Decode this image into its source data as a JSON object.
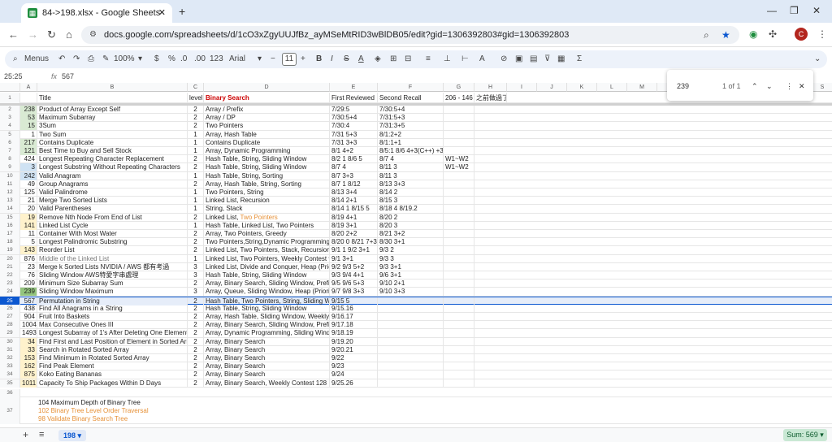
{
  "browser": {
    "tab_title": "84->198.xlsx - Google Sheets",
    "url": "docs.google.com/spreadsheets/d/1cO3xZgyUUJfBz_ayMSeMtRID3wBlDB05/edit?gid=1306392803#gid=1306392803",
    "avatar_letter": "C"
  },
  "toolbar": {
    "menus": "Menus",
    "zoom": "100%",
    "currency": "$",
    "percent": "%",
    "dec_down": ".0",
    "dec_up": ".00",
    "format123": "123",
    "font": "Arial",
    "font_size": "11"
  },
  "formula": {
    "namebox": "25:25",
    "fx": "fx",
    "value": "567"
  },
  "find": {
    "query": "239",
    "count": "1 of 1"
  },
  "columns": [
    "A",
    "B",
    "C",
    "D",
    "E",
    "F",
    "G",
    "H",
    "I",
    "J",
    "K",
    "L",
    "M",
    "N",
    "O",
    "P",
    "Q",
    "R",
    "S"
  ],
  "header_row": {
    "title": "Title",
    "level": "level",
    "tag": "Binary Search",
    "first": "First Reviewed",
    "second": "Second Recall",
    "g": "206 - 146",
    "h": "之前做過了"
  },
  "rows": [
    {
      "n": "2",
      "a": "238",
      "b": "Product of Array Except Self",
      "c": "2",
      "d": "Array / Prefix",
      "e": "7/29:5",
      "f": "7/30:5+4",
      "g": ""
    },
    {
      "n": "3",
      "a": "53",
      "b": "Maximum Subarray",
      "c": "2",
      "d": "Array / DP",
      "e": "7/30:5+4",
      "f": "7/31:5+3",
      "g": ""
    },
    {
      "n": "4",
      "a": "15",
      "b": "3Sum",
      "c": "2",
      "d": "Two Pointers",
      "e": "7/30:4",
      "f": "7/31:3+5",
      "g": ""
    },
    {
      "n": "5",
      "a": "1",
      "b": "Two Sum",
      "c": "1",
      "d": "Array, Hash Table",
      "e": "7/31 5+3",
      "f": "8/1:2+2",
      "g": ""
    },
    {
      "n": "6",
      "a": "217",
      "b": "Contains Duplicate",
      "c": "1",
      "d": "Contains Duplicate",
      "e": "7/31 3+3",
      "f": "8/1:1+1",
      "g": ""
    },
    {
      "n": "7",
      "a": "121",
      "b": "Best Time to Buy and Sell Stock",
      "c": "1",
      "d": "Array, Dynamic Programming",
      "e": "8/1 4+2",
      "f": "8/5:1 8/6 4+3(C++) +3",
      "g": ""
    },
    {
      "n": "8",
      "a": "424",
      "b": "Longest Repeating Character Replacement",
      "c": "2",
      "d": "Hash Table, String, Sliding Window",
      "e": "8/2 1 8/6 5",
      "f": "8/7 4",
      "g": "W1~W2"
    },
    {
      "n": "9",
      "a": "3",
      "b": "Longest Substring Without Repeating Characters",
      "c": "2",
      "d": "Hash Table, String, Sliding Window",
      "e": "8/7 4",
      "f": "8/11 3",
      "g": "W1~W2"
    },
    {
      "n": "10",
      "a": "242",
      "b": "Valid Anagram",
      "c": "1",
      "d": "Hash Table, String, Sorting",
      "e": "8/7 3+3",
      "f": "8/11 3",
      "g": ""
    },
    {
      "n": "11",
      "a": "49",
      "b": "Group Anagrams",
      "c": "2",
      "d": "Array, Hash Table, String, Sorting",
      "e": "8/7 1 8/12",
      "f": "8/13 3+3",
      "g": ""
    },
    {
      "n": "12",
      "a": "125",
      "b": "Valid Palindrome",
      "c": "1",
      "d": "Two Pointers, String",
      "e": "8/13 3+4",
      "f": "8/14 2",
      "g": ""
    },
    {
      "n": "13",
      "a": "21",
      "b": "Merge Two Sorted Lists",
      "c": "1",
      "d": "Linked List, Recursion",
      "e": "8/14 2+1",
      "f": "8/15 3",
      "g": ""
    },
    {
      "n": "14",
      "a": "20",
      "b": "Valid Parentheses",
      "c": "1",
      "d": "String, Stack",
      "e": "8/14 1 8/15 5",
      "f": "8/18 4 8/19.2",
      "g": ""
    },
    {
      "n": "15",
      "a": "19",
      "b": "Remove Nth Node From End of List",
      "c": "2",
      "d": "Linked List, ",
      "d2": "Two Pointers",
      "e": "8/19 4+1",
      "f": "8/20 2",
      "g": ""
    },
    {
      "n": "16",
      "a": "141",
      "b": "Linked List Cycle",
      "c": "1",
      "d": "Hash Table, Linked List, Two Pointers",
      "e": "8/19 3+1",
      "f": "8/20 3",
      "g": ""
    },
    {
      "n": "17",
      "a": "11",
      "b": "Container With Most Water",
      "c": "2",
      "d": "Array, Two Pointers, Greedy",
      "e": "8/20 2+2",
      "f": "8/21 3+2",
      "g": ""
    },
    {
      "n": "18",
      "a": "5",
      "b": "Longest Palindromic Substring",
      "c": "2",
      "d": "Two Pointers,String,Dynamic Programming",
      "e": "8/20 0 8/21 7+3",
      "f": "8/30 3+1",
      "g": ""
    },
    {
      "n": "19",
      "a": "143",
      "b": "Reorder List",
      "c": "2",
      "d": "Linked List, Two Pointers, Stack, Recursion",
      "e": "9/1 1 9/2 3+1",
      "f": "9/3 2",
      "g": ""
    },
    {
      "n": "20",
      "a": "876",
      "b": "Middle of the Linked List",
      "c": "1",
      "d": "Linked List, Two Pointers, Weekly Contest 9",
      "e": "9/1 3+1",
      "f": "9/3 3",
      "g": ""
    },
    {
      "n": "21",
      "a": "23",
      "b": " Merge k Sorted Lists NVIDIA / AWS 都有考過",
      "c": "3",
      "d": "Linked List, Divide and Conquer, Heap (Prio",
      "e": "9/2 9/3 5+2",
      "f": "9/3 3+1",
      "g": ""
    },
    {
      "n": "22",
      "a": "76",
      "b": "Sliding Window AWS特愛字串處理",
      "c": "3",
      "d": "Hash Table, String, Sliding Window",
      "e": "9/3 9/4 4+1",
      "f": "9/6 3+1",
      "g": ""
    },
    {
      "n": "23",
      "a": "209",
      "b": "Minimum Size Subarray Sum",
      "c": "2",
      "d": "Array, Binary Search, Sliding Window, Prefix",
      "e": "9/5 9/6 5+3",
      "f": "9/10 2+1",
      "g": ""
    },
    {
      "n": "24",
      "a": "239",
      "b": "Sliding Window Maximum",
      "c": "3",
      "d": "Array, Queue, Sliding Window, Heap (Priorit",
      "e": "9/7 9/8 3+3",
      "f": "9/10 3+3",
      "g": ""
    },
    {
      "n": "25",
      "a": "567",
      "b": "Permutation in String",
      "c": "2",
      "d": "Hash Table, Two Pointers, String, Sliding Wi",
      "e": "9/15 5",
      "f": "",
      "g": ""
    },
    {
      "n": "26",
      "a": "438",
      "b": "Find All Anagrams in a String",
      "c": "2",
      "d": "Hash Table, String, Sliding Window",
      "e": "9/15.16",
      "f": "",
      "g": ""
    },
    {
      "n": "27",
      "a": "904",
      "b": "Fruit Into Baskets",
      "c": "2",
      "d": "Array, Hash Table, Sliding Window, Weekly",
      "e": "9/16.17",
      "f": "",
      "g": ""
    },
    {
      "n": "28",
      "a": "1004",
      "b": "Max Consecutive Ones III",
      "c": "2",
      "d": "Array, Binary Search, Sliding Window, Prefix",
      "e": "9/17.18",
      "f": "",
      "g": ""
    },
    {
      "n": "29",
      "a": "1493",
      "b": "Longest Subarray of 1's After Deleting One Element",
      "c": "2",
      "d": "Array, Dynamic Programming, Sliding Windo",
      "e": "9/18.19",
      "f": "",
      "g": ""
    },
    {
      "n": "30",
      "a": "34",
      "b": "Find First and Last Position of Element in Sorted Arra",
      "c": "2",
      "d": "Array, Binary Search",
      "e": "9/19.20",
      "f": "",
      "g": ""
    },
    {
      "n": "31",
      "a": "33",
      "b": "Search in Rotated Sorted Array",
      "c": "2",
      "d": "Array, Binary Search",
      "e": "9/20.21",
      "f": "",
      "g": ""
    },
    {
      "n": "32",
      "a": "153",
      "b": "Find Minimum in Rotated Sorted Array",
      "c": "2",
      "d": "Array, Binary Search",
      "e": "9/22",
      "f": "",
      "g": ""
    },
    {
      "n": "33",
      "a": "162",
      "b": "Find Peak Element",
      "c": "2",
      "d": "Array, Binary Search",
      "e": "9/23",
      "f": "",
      "g": ""
    },
    {
      "n": "34",
      "a": "875",
      "b": "Koko Eating Bananas",
      "c": "2",
      "d": "Array, Binary Search",
      "e": "9/24",
      "f": "",
      "g": ""
    },
    {
      "n": "35",
      "a": "1011",
      "b": "Capacity To Ship Packages Within D Days",
      "c": "2",
      "d": "Array, Binary Search, Weekly Contest 128",
      "e": "9/25.26",
      "f": "",
      "g": ""
    }
  ],
  "notes": {
    "r36": "36",
    "r37": "37",
    "line1": "104 Maximum Depth of Binary Tree",
    "line2": "102 Binary Tree Level Order Traversal",
    "line3": "98 Validate Binary Search Tree"
  },
  "status": {
    "sheet_tab": "198",
    "sum": "Sum: 569"
  },
  "colors": {
    "accent": "#0b57d0",
    "orange": "#e69138",
    "red": "#cc0000",
    "green_cell": "#d9ead3",
    "blue_cell": "#cfe2f3",
    "yellow_cell": "#fff2cc"
  }
}
